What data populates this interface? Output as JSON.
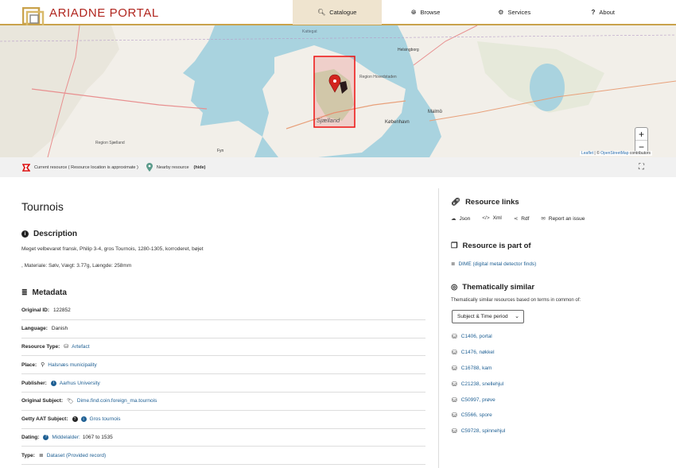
{
  "header": {
    "logo_text": "ARIADNE PORTAL",
    "nav": [
      {
        "label": "Catalogue",
        "icon": "search-icon",
        "glyph": "🔍",
        "active": true
      },
      {
        "label": "Browse",
        "icon": "globe-icon",
        "glyph": "🌐",
        "active": false
      },
      {
        "label": "Services",
        "icon": "gear-icon",
        "glyph": "⚙",
        "active": false
      },
      {
        "label": "About",
        "icon": "question-icon",
        "glyph": "?",
        "active": false
      }
    ]
  },
  "map": {
    "place_label": "Sjælland",
    "city_labels": [
      "København",
      "Malmö",
      "Helsingborg",
      "Fyn",
      "Region Sjælland",
      "Region Hovedstaden",
      "Kattegat"
    ],
    "zoom_in": "+",
    "zoom_out": "−",
    "attribution_leaflet": "Leaflet",
    "attribution_sep": " | © ",
    "attribution_osm": "OpenStreetMap",
    "attribution_tail": " contributors"
  },
  "legend": {
    "current": "Current resource ( Resource location is approximate )",
    "nearby": "Nearby resource",
    "hide": "(hide)"
  },
  "resource": {
    "title": "Tournois",
    "description_heading": "Description",
    "description_line1": "Meget velbevaret fransk, Philip 3-4, gros Tournois, 1280-1305, korroderet, bøjet",
    "description_line2": ", Materiale: Sølv, Vægt: 3.77g, Længde: 258mm",
    "metadata_heading": "Metadata",
    "metadata": [
      {
        "key": "Original ID:",
        "value": "122852",
        "icon": "",
        "link": false
      },
      {
        "key": "Language:",
        "value": "Danish",
        "icon": "",
        "link": false
      },
      {
        "key": "Resource Type:",
        "value": "Artefact",
        "icon": "artefact-icon",
        "link": true
      },
      {
        "key": "Place:",
        "value": "Halsnæs municipality",
        "icon": "map-pin-icon",
        "link": true
      },
      {
        "key": "Publisher:",
        "value": "Aarhus University",
        "icon": "info-icon",
        "link": true
      },
      {
        "key": "Original Subject:",
        "value": "Dime.find.coin.foreign_ma.tournois",
        "icon": "tag-icon",
        "link": true
      },
      {
        "key": "Getty AAT Subject:",
        "value": "Gros tournois",
        "icon": "info-icon",
        "link": true
      },
      {
        "key": "Dating:",
        "value": "1067 to 1535",
        "prefix": "Middelalder:",
        "icon": "question-icon",
        "link": false
      },
      {
        "key": "Type:",
        "value": "Dataset (Provided record)",
        "icon": "database-icon",
        "link": true
      }
    ]
  },
  "sidebar": {
    "resource_links_heading": "Resource links",
    "links": [
      {
        "label": "Json",
        "icon": "cloud-download-icon",
        "glyph": "☁"
      },
      {
        "label": "Xml",
        "icon": "code-icon",
        "glyph": "</>"
      },
      {
        "label": "Rdf",
        "icon": "share-icon",
        "glyph": "⋖"
      },
      {
        "label": "Report an issue",
        "icon": "envelope-icon",
        "glyph": "✉"
      }
    ],
    "part_of_heading": "Resource is part of",
    "part_of": "DIME (digital metal detector finds)",
    "similar_heading": "Thematically similar",
    "similar_desc": "Thematically similar resources based on terms in common of:",
    "select_value": "Subject & Time period",
    "similar": [
      "C1406, portal",
      "C1476, nøkkel",
      "C16788, kam",
      "C21238, snellehjul",
      "C50997, prøve",
      "C5566, spore",
      "C59728, spinnehjul"
    ]
  },
  "colors": {
    "brand_red": "#b1261f",
    "gold": "#c9a24b",
    "link": "#1e5f93",
    "active_nav": "#efe4cf"
  }
}
